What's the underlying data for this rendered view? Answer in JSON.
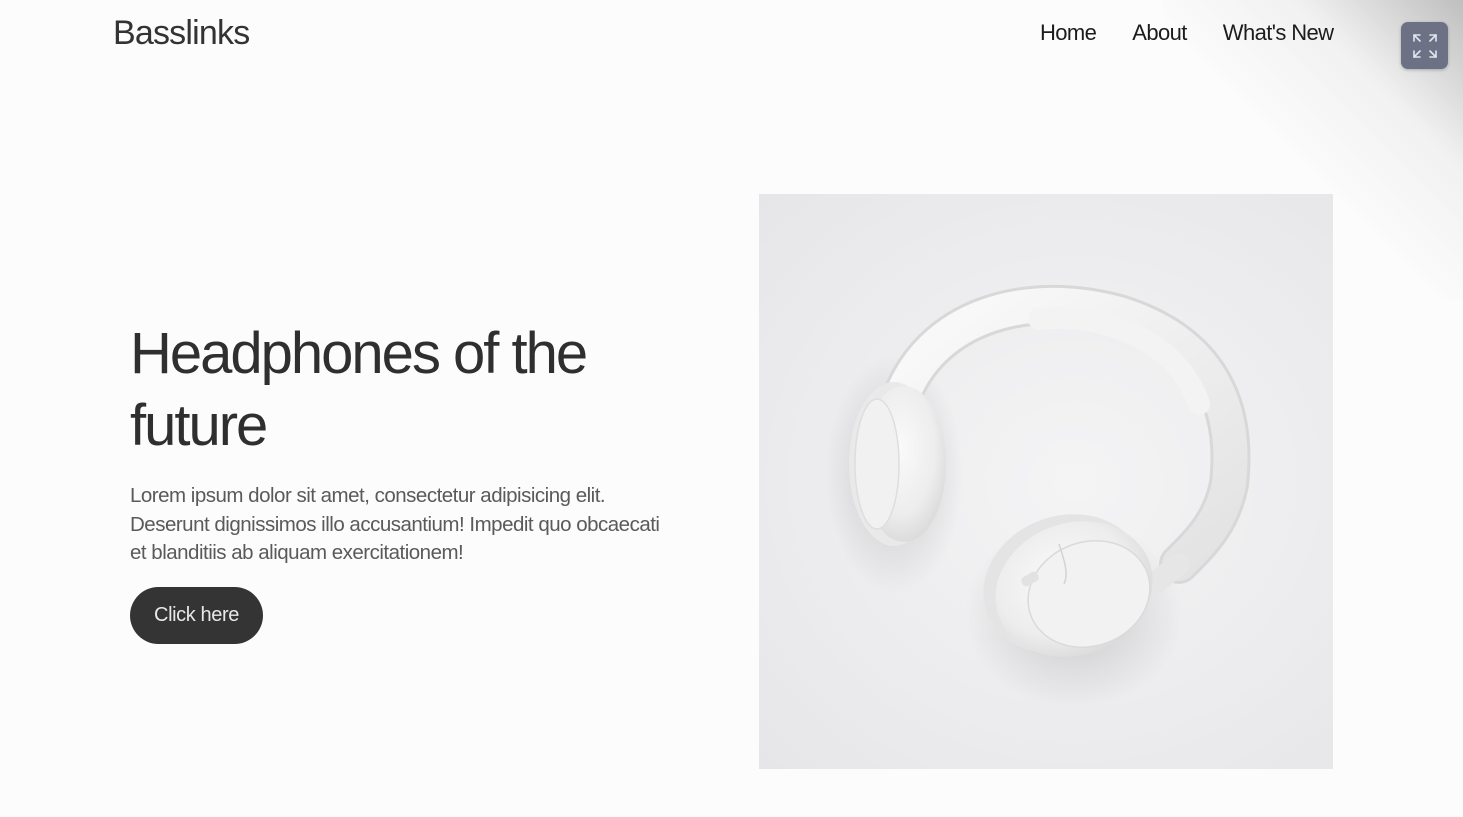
{
  "header": {
    "brand": "Basslinks",
    "nav": [
      {
        "label": "Home"
      },
      {
        "label": "About"
      },
      {
        "label": "What's New"
      }
    ],
    "expand_icon": "expand-arrows-icon"
  },
  "hero": {
    "title": "Headphones of the future",
    "description": "Lorem ipsum dolor sit amet, consectetur adipisicing elit. Deserunt dignissimos illo accusantium! Impedit quo obcaecati et blanditiis ab aliquam exercitationem!",
    "button_label": "Click here",
    "image": "white-headphones-photo"
  },
  "colors": {
    "background": "#fcfcfc",
    "text": "#2f2f2f",
    "button": "#343434",
    "expand_button": "#6c7186"
  }
}
